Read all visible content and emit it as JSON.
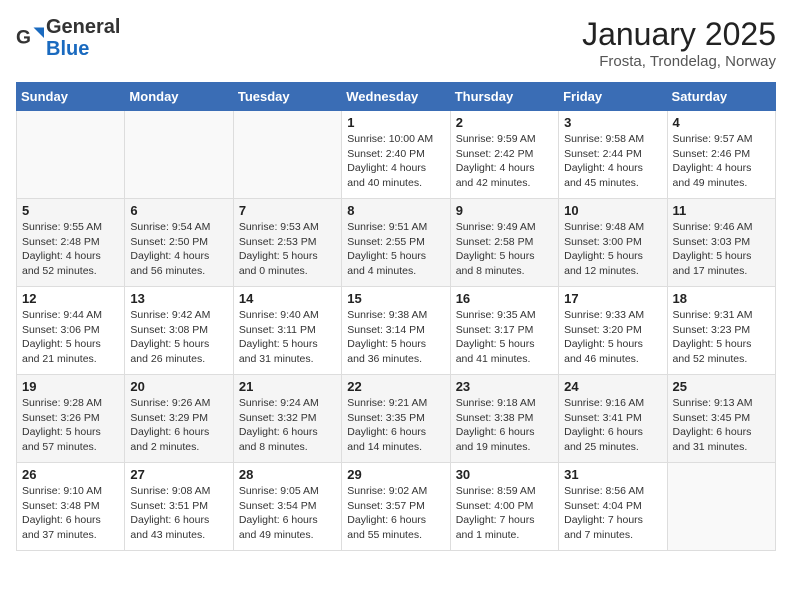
{
  "logo": {
    "general": "General",
    "blue": "Blue"
  },
  "title": "January 2025",
  "location": "Frosta, Trondelag, Norway",
  "days_of_week": [
    "Sunday",
    "Monday",
    "Tuesday",
    "Wednesday",
    "Thursday",
    "Friday",
    "Saturday"
  ],
  "weeks": [
    [
      {
        "day": "",
        "info": ""
      },
      {
        "day": "",
        "info": ""
      },
      {
        "day": "",
        "info": ""
      },
      {
        "day": "1",
        "info": "Sunrise: 10:00 AM\nSunset: 2:40 PM\nDaylight: 4 hours and 40 minutes."
      },
      {
        "day": "2",
        "info": "Sunrise: 9:59 AM\nSunset: 2:42 PM\nDaylight: 4 hours and 42 minutes."
      },
      {
        "day": "3",
        "info": "Sunrise: 9:58 AM\nSunset: 2:44 PM\nDaylight: 4 hours and 45 minutes."
      },
      {
        "day": "4",
        "info": "Sunrise: 9:57 AM\nSunset: 2:46 PM\nDaylight: 4 hours and 49 minutes."
      }
    ],
    [
      {
        "day": "5",
        "info": "Sunrise: 9:55 AM\nSunset: 2:48 PM\nDaylight: 4 hours and 52 minutes."
      },
      {
        "day": "6",
        "info": "Sunrise: 9:54 AM\nSunset: 2:50 PM\nDaylight: 4 hours and 56 minutes."
      },
      {
        "day": "7",
        "info": "Sunrise: 9:53 AM\nSunset: 2:53 PM\nDaylight: 5 hours and 0 minutes."
      },
      {
        "day": "8",
        "info": "Sunrise: 9:51 AM\nSunset: 2:55 PM\nDaylight: 5 hours and 4 minutes."
      },
      {
        "day": "9",
        "info": "Sunrise: 9:49 AM\nSunset: 2:58 PM\nDaylight: 5 hours and 8 minutes."
      },
      {
        "day": "10",
        "info": "Sunrise: 9:48 AM\nSunset: 3:00 PM\nDaylight: 5 hours and 12 minutes."
      },
      {
        "day": "11",
        "info": "Sunrise: 9:46 AM\nSunset: 3:03 PM\nDaylight: 5 hours and 17 minutes."
      }
    ],
    [
      {
        "day": "12",
        "info": "Sunrise: 9:44 AM\nSunset: 3:06 PM\nDaylight: 5 hours and 21 minutes."
      },
      {
        "day": "13",
        "info": "Sunrise: 9:42 AM\nSunset: 3:08 PM\nDaylight: 5 hours and 26 minutes."
      },
      {
        "day": "14",
        "info": "Sunrise: 9:40 AM\nSunset: 3:11 PM\nDaylight: 5 hours and 31 minutes."
      },
      {
        "day": "15",
        "info": "Sunrise: 9:38 AM\nSunset: 3:14 PM\nDaylight: 5 hours and 36 minutes."
      },
      {
        "day": "16",
        "info": "Sunrise: 9:35 AM\nSunset: 3:17 PM\nDaylight: 5 hours and 41 minutes."
      },
      {
        "day": "17",
        "info": "Sunrise: 9:33 AM\nSunset: 3:20 PM\nDaylight: 5 hours and 46 minutes."
      },
      {
        "day": "18",
        "info": "Sunrise: 9:31 AM\nSunset: 3:23 PM\nDaylight: 5 hours and 52 minutes."
      }
    ],
    [
      {
        "day": "19",
        "info": "Sunrise: 9:28 AM\nSunset: 3:26 PM\nDaylight: 5 hours and 57 minutes."
      },
      {
        "day": "20",
        "info": "Sunrise: 9:26 AM\nSunset: 3:29 PM\nDaylight: 6 hours and 2 minutes."
      },
      {
        "day": "21",
        "info": "Sunrise: 9:24 AM\nSunset: 3:32 PM\nDaylight: 6 hours and 8 minutes."
      },
      {
        "day": "22",
        "info": "Sunrise: 9:21 AM\nSunset: 3:35 PM\nDaylight: 6 hours and 14 minutes."
      },
      {
        "day": "23",
        "info": "Sunrise: 9:18 AM\nSunset: 3:38 PM\nDaylight: 6 hours and 19 minutes."
      },
      {
        "day": "24",
        "info": "Sunrise: 9:16 AM\nSunset: 3:41 PM\nDaylight: 6 hours and 25 minutes."
      },
      {
        "day": "25",
        "info": "Sunrise: 9:13 AM\nSunset: 3:45 PM\nDaylight: 6 hours and 31 minutes."
      }
    ],
    [
      {
        "day": "26",
        "info": "Sunrise: 9:10 AM\nSunset: 3:48 PM\nDaylight: 6 hours and 37 minutes."
      },
      {
        "day": "27",
        "info": "Sunrise: 9:08 AM\nSunset: 3:51 PM\nDaylight: 6 hours and 43 minutes."
      },
      {
        "day": "28",
        "info": "Sunrise: 9:05 AM\nSunset: 3:54 PM\nDaylight: 6 hours and 49 minutes."
      },
      {
        "day": "29",
        "info": "Sunrise: 9:02 AM\nSunset: 3:57 PM\nDaylight: 6 hours and 55 minutes."
      },
      {
        "day": "30",
        "info": "Sunrise: 8:59 AM\nSunset: 4:00 PM\nDaylight: 7 hours and 1 minute."
      },
      {
        "day": "31",
        "info": "Sunrise: 8:56 AM\nSunset: 4:04 PM\nDaylight: 7 hours and 7 minutes."
      },
      {
        "day": "",
        "info": ""
      }
    ]
  ]
}
